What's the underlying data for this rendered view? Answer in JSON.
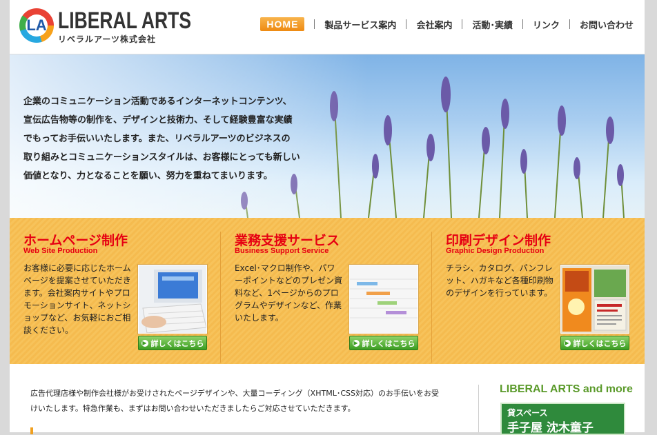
{
  "header": {
    "logo_mark_letter": "LA",
    "logo_title": "LIBERAL ARTS",
    "logo_sub": "リベラルアーツ株式会社",
    "nav": {
      "home": "HOME",
      "products": "製品サービス案内",
      "company": "会社案内",
      "activities": "活動･実績",
      "links": "リンク",
      "contact": "お問い合わせ"
    }
  },
  "hero": {
    "lines": [
      "企業のコミュニケーション活動であるインターネットコンテンツ、",
      "宣伝広告物等の制作を、デザインと技術力、そして経験豊富な実績",
      "でもってお手伝いいたします。また、リベラルアーツのビジネスの",
      "取り組みとコミュニケーションスタイルは、お客様にとっても新しい",
      "価値となり、力となることを願い、努力を重ねてまいります。"
    ]
  },
  "services": [
    {
      "title": "ホームページ制作",
      "en": "Web Site Production",
      "desc": "お客様に必要に応じたホームページを提案させていただきます。会社案内サイトやプロモーションサイト、ネットショップなど、お気軽におご相談ください。",
      "button": "詳しくはこちら"
    },
    {
      "title": "業務支援サービス",
      "en": "Business Support Service",
      "desc": "Excel･マクロ制作や、パワーポイントなどのプレゼン資料など、1ページからのプログラムやデザインなど、作業いたします。",
      "button": "詳しくはこちら"
    },
    {
      "title": "印刷デザイン制作",
      "en": "Graphic Design Production",
      "desc": "チラシ、カタログ、パンフレット、ハガキなど各種印刷物のデザインを行っています。",
      "button": "詳しくはこちら"
    }
  ],
  "bottom": {
    "line1": "広告代理店様や制作会社様がお受けされたページデザインや、大量コーディング（XHTML･CSS対応）のお手伝いをお受",
    "line2": "けいたします。特急作業も、まずはお問い合わせいただきましたらご対応させていただきます。",
    "more_title": "LIBERAL ARTS and more",
    "banner_top": "貸スペース",
    "banner_main": "手子屋 沈木童子"
  }
}
